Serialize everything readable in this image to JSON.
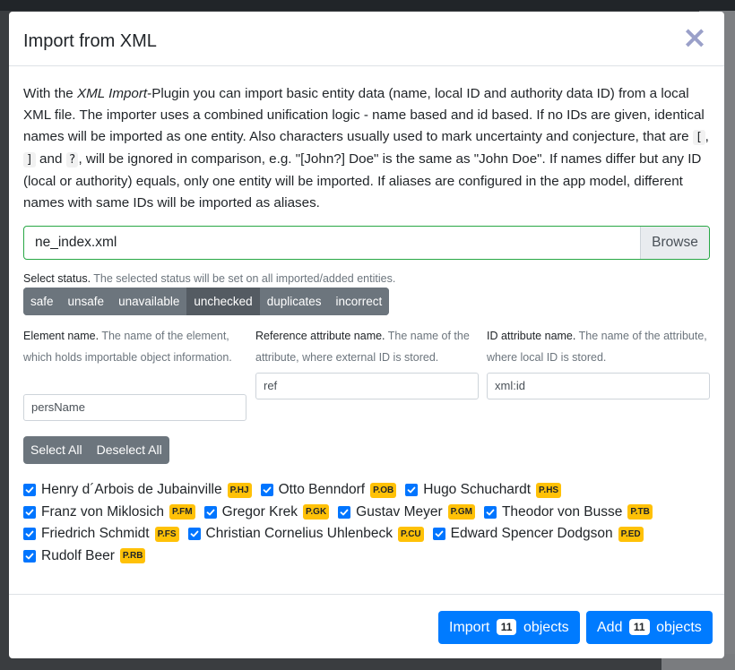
{
  "modal": {
    "title": "Import from XML",
    "close_label": "×",
    "intro": {
      "t1": "With the ",
      "em": "XML Import",
      "t2": "-Plugin you can import basic entity data (name, local ID and authority data ID) from a local XML file. The importer uses a combined unification logic - name based and id based. If no IDs are given, identical names will be imported as one entity. Also characters usually used to mark uncertainty and conjecture, that are ",
      "code1": "[",
      "sep1": ", ",
      "code2": "]",
      "sep2": " and ",
      "code3": "?",
      "t3": ", will be ignored in comparison, e.g. \"[John?] Doe\" is the same as \"John Doe\". If names differ but any ID (local or authority) equals, only one entity will be imported. If aliases are configured in the app model, different names with same IDs will be imported as aliases."
    },
    "file": {
      "name": "ne_index.xml",
      "browse_label": "Browse"
    },
    "status": {
      "label": "Select status.",
      "hint": "The selected status will be set on all imported/added entities.",
      "options": [
        "safe",
        "unsafe",
        "unavailable",
        "unchecked",
        "duplicates",
        "incorrect"
      ],
      "selected": "unchecked"
    },
    "fields": {
      "element": {
        "label": "Element name.",
        "hint": "The name of the element, which holds importable object information.",
        "value": "persName"
      },
      "reference": {
        "label": "Reference attribute name.",
        "hint": "The name of the attribute, where external ID is stored.",
        "value": "ref"
      },
      "id": {
        "label": "ID attribute name.",
        "hint": "The name of the attribute, where local ID is stored.",
        "value": "xml:id"
      }
    },
    "selection": {
      "select_all": "Select All",
      "deselect_all": "Deselect All"
    },
    "entities": [
      {
        "name": "Henry d´Arbois de Jubainville",
        "badge": "P.HJ",
        "checked": true
      },
      {
        "name": "Otto Benndorf",
        "badge": "P.OB",
        "checked": true
      },
      {
        "name": "Hugo Schuchardt",
        "badge": "P.HS",
        "checked": true
      },
      {
        "name": "Franz von Miklosich",
        "badge": "P.FM",
        "checked": true
      },
      {
        "name": "Gregor Krek",
        "badge": "P.GK",
        "checked": true
      },
      {
        "name": "Gustav Meyer",
        "badge": "P.GM",
        "checked": true
      },
      {
        "name": "Theodor von Busse",
        "badge": "P.TB",
        "checked": true
      },
      {
        "name": "Friedrich Schmidt",
        "badge": "P.FS",
        "checked": true
      },
      {
        "name": "Christian Cornelius Uhlenbeck",
        "badge": "P.CU",
        "checked": true
      },
      {
        "name": "Edward Spencer Dodgson",
        "badge": "P.ED",
        "checked": true
      },
      {
        "name": "Rudolf Beer",
        "badge": "P.RB",
        "checked": true
      }
    ],
    "footer": {
      "import": {
        "pre": "Import",
        "count": "11",
        "post": "objects"
      },
      "add": {
        "pre": "Add",
        "count": "11",
        "post": "objects"
      }
    }
  },
  "colors": {
    "primary": "#007bff",
    "secondary": "#6c757d",
    "badge": "#ffc107",
    "valid_border": "#28a745",
    "checkbox": "#0075ff"
  }
}
